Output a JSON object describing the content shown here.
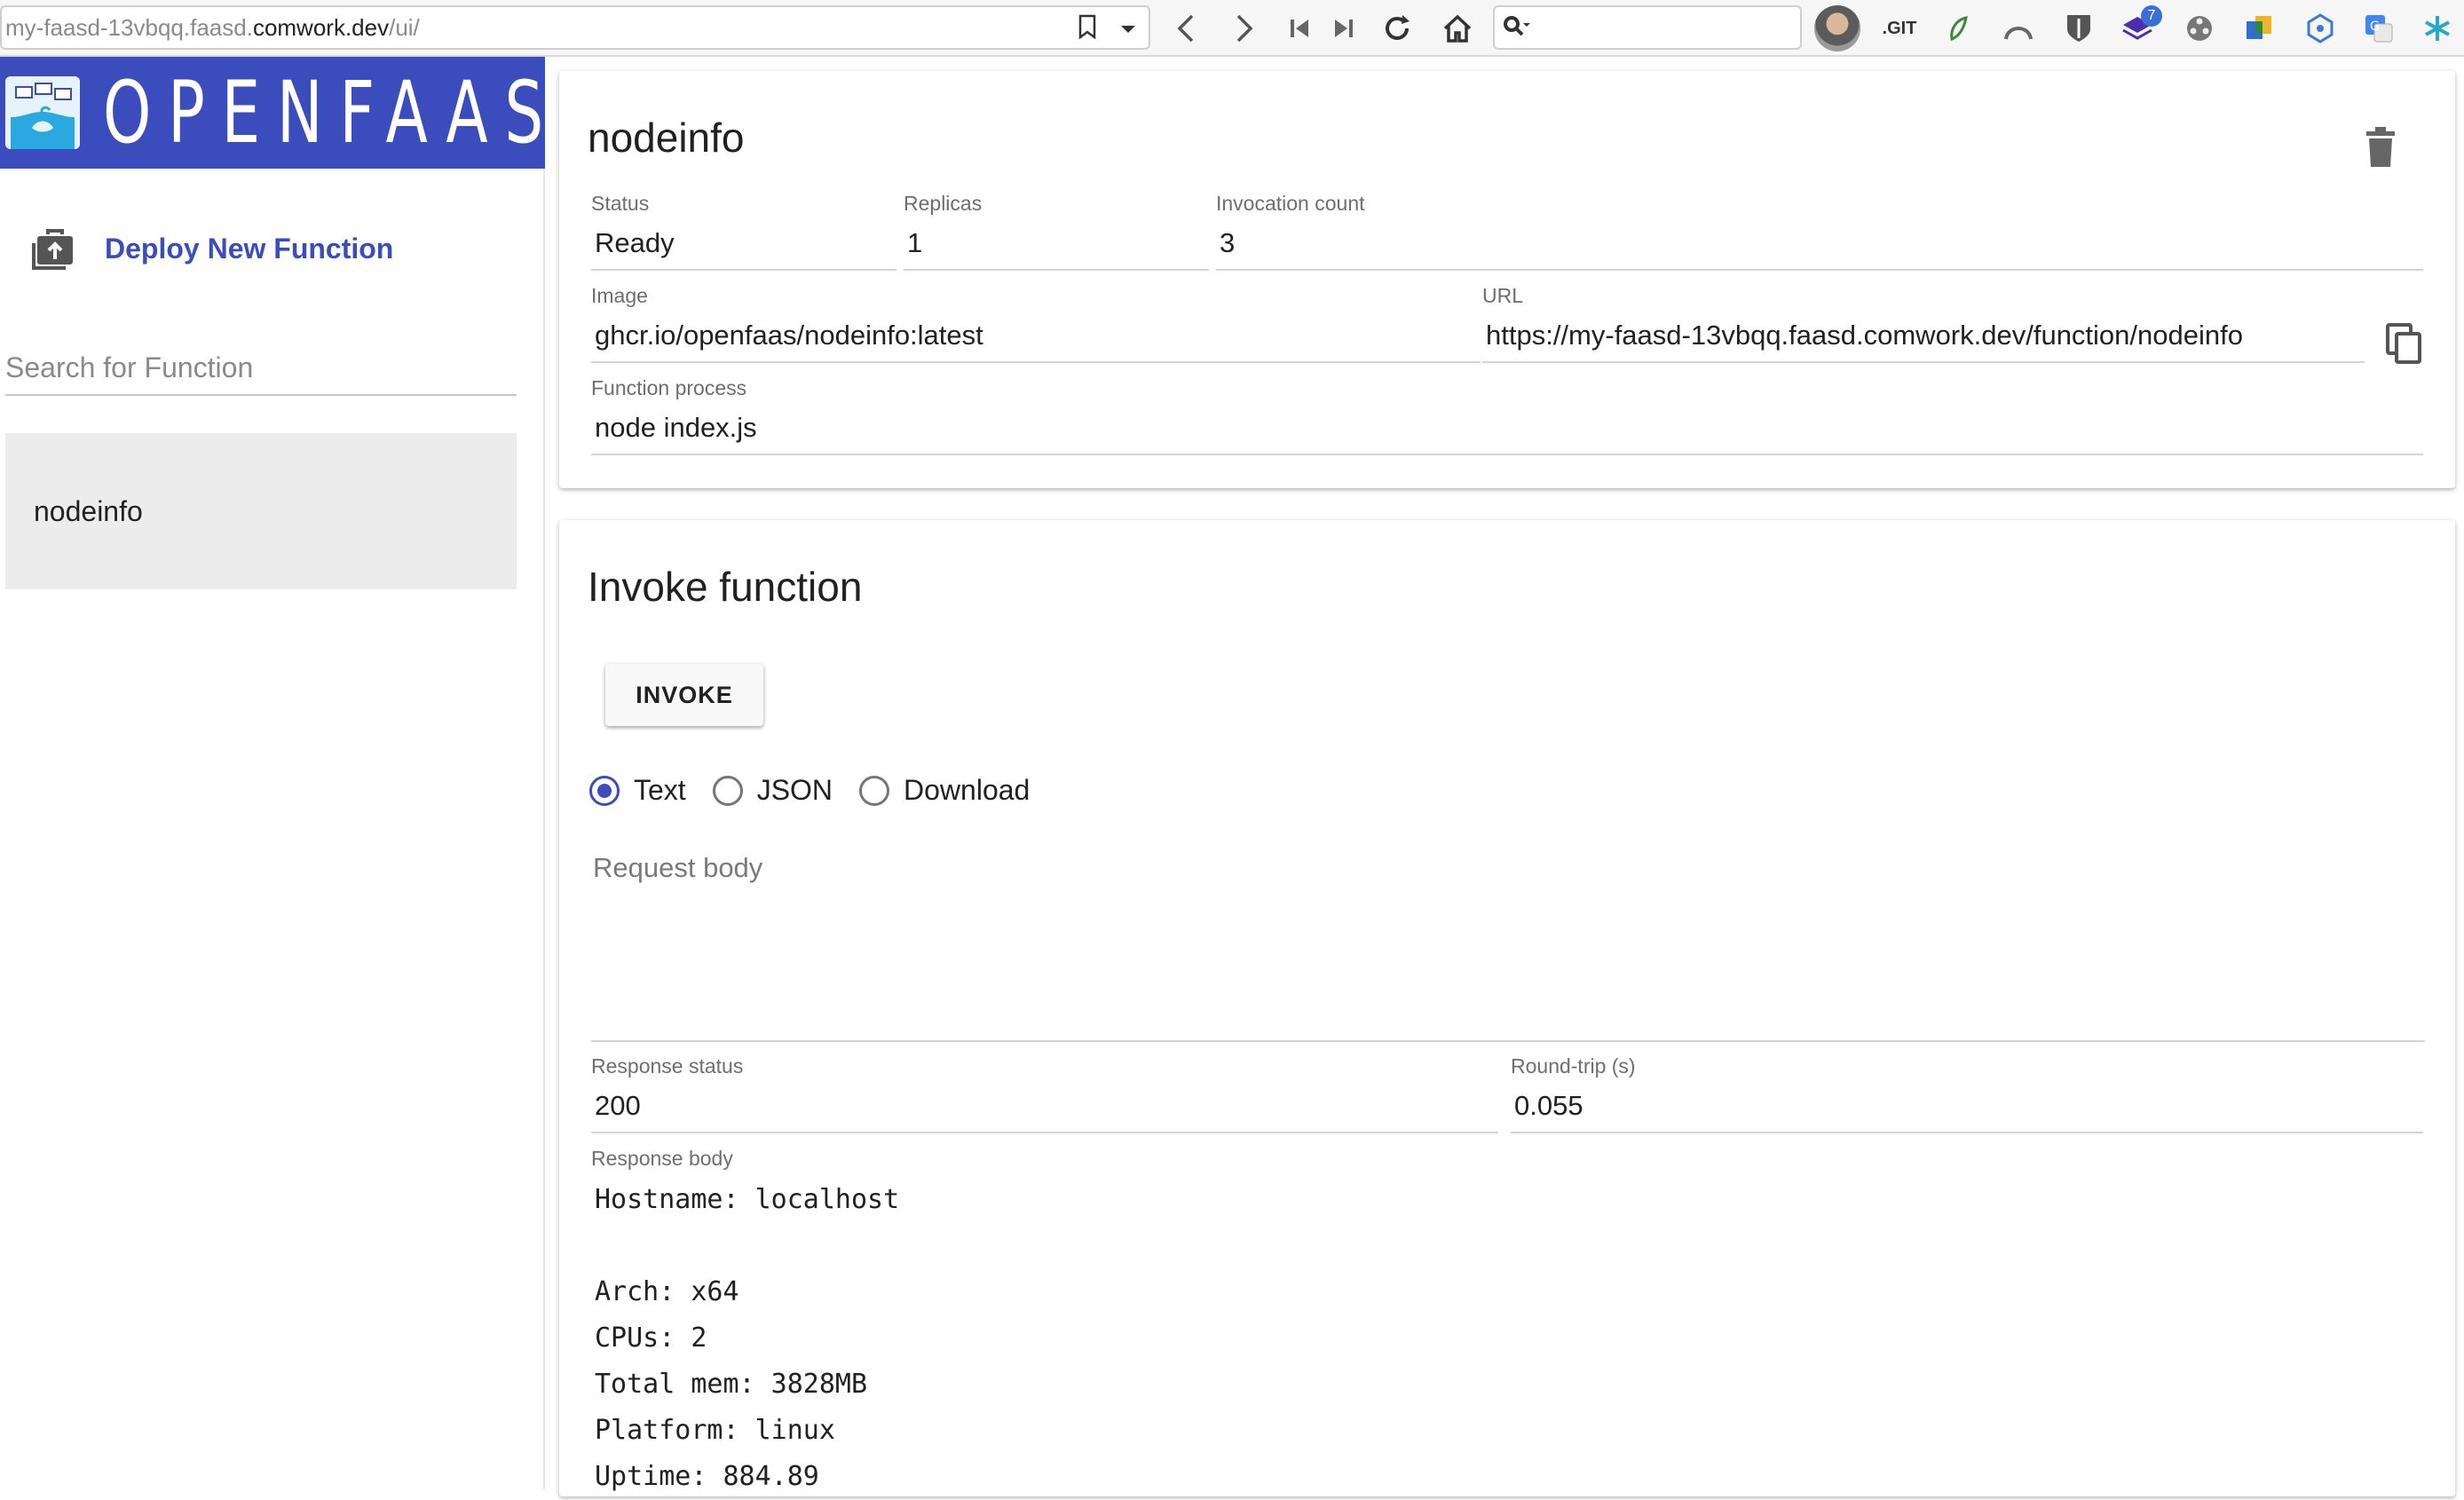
{
  "browser": {
    "url_prefix": "my-faasd-13vbqq.faasd.",
    "url_host": "comwork.dev",
    "url_suffix": "/ui/",
    "git_label": ".GIT",
    "badge_count": "7"
  },
  "sidebar": {
    "brand": "OPENFAAS",
    "deploy_label": "Deploy New Function",
    "search_placeholder": "Search for Function",
    "functions": [
      {
        "label": "nodeinfo"
      }
    ]
  },
  "function_card": {
    "title": "nodeinfo",
    "status_label": "Status",
    "status_value": "Ready",
    "replicas_label": "Replicas",
    "replicas_value": "1",
    "invocation_label": "Invocation count",
    "invocation_value": "3",
    "image_label": "Image",
    "image_value": "ghcr.io/openfaas/nodeinfo:latest",
    "url_label": "URL",
    "url_value": "https://my-faasd-13vbqq.faasd.comwork.dev/function/nodeinfo",
    "process_label": "Function process",
    "process_value": "node index.js"
  },
  "invoke_card": {
    "title": "Invoke function",
    "invoke_button": "INVOKE",
    "formats": [
      "Text",
      "JSON",
      "Download"
    ],
    "selected_format": "Text",
    "request_placeholder": "Request body",
    "response_status_label": "Response status",
    "response_status_value": "200",
    "roundtrip_label": "Round-trip (s)",
    "roundtrip_value": "0.055",
    "response_body_label": "Response body",
    "response_body": "Hostname: localhost\n\nArch: x64\nCPUs: 2\nTotal mem: 3828MB\nPlatform: linux\nUptime: 884.89"
  },
  "colors": {
    "brand": "#3b4dbd",
    "link": "#3b4dbd"
  }
}
